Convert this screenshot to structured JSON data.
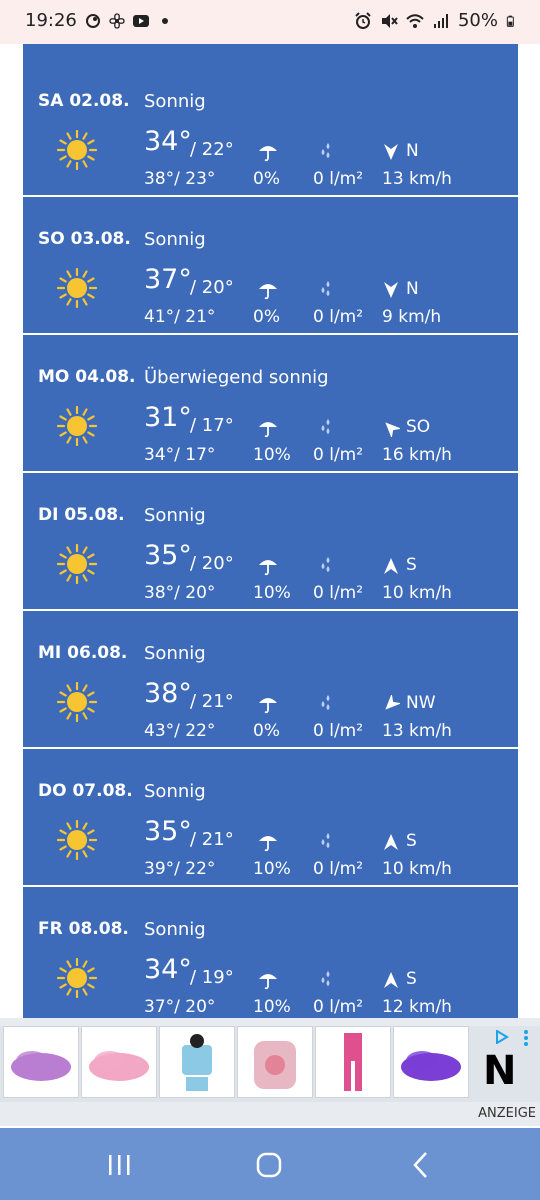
{
  "status_bar": {
    "time": "19:26",
    "battery": "50%",
    "left_icons": [
      "notification-icon",
      "fan-icon",
      "youtube-icon",
      "dot-icon"
    ],
    "right_icons": [
      "alarm-icon",
      "mute-icon",
      "wifi-icon",
      "signal-icon",
      "battery-icon"
    ]
  },
  "forecast": [
    {
      "date": "SA 02.08.",
      "condition": "Sonnig",
      "max": "34°",
      "min": "/ 22°",
      "feels": "38°/ 23°",
      "rain_prob": "0%",
      "rain_amount": "0 l/m²",
      "wind_dir": "N",
      "wind_speed": "13 km/h",
      "wind_arrow_rotation": 180
    },
    {
      "date": "SO 03.08.",
      "condition": "Sonnig",
      "max": "37°",
      "min": "/ 20°",
      "feels": "41°/ 21°",
      "rain_prob": "0%",
      "rain_amount": "0 l/m²",
      "wind_dir": "N",
      "wind_speed": "9 km/h",
      "wind_arrow_rotation": 180
    },
    {
      "date": "MO 04.08.",
      "condition": "Überwiegend sonnig",
      "max": "31°",
      "min": "/ 17°",
      "feels": "34°/ 17°",
      "rain_prob": "10%",
      "rain_amount": "0 l/m²",
      "wind_dir": "SO",
      "wind_speed": "16 km/h",
      "wind_arrow_rotation": -45
    },
    {
      "date": "DI 05.08.",
      "condition": "Sonnig",
      "max": "35°",
      "min": "/ 20°",
      "feels": "38°/ 20°",
      "rain_prob": "10%",
      "rain_amount": "0 l/m²",
      "wind_dir": "S",
      "wind_speed": "10 km/h",
      "wind_arrow_rotation": 0
    },
    {
      "date": "MI 06.08.",
      "condition": "Sonnig",
      "max": "38°",
      "min": "/ 21°",
      "feels": "43°/ 22°",
      "rain_prob": "0%",
      "rain_amount": "0 l/m²",
      "wind_dir": "NW",
      "wind_speed": "13 km/h",
      "wind_arrow_rotation": 225
    },
    {
      "date": "DO 07.08.",
      "condition": "Sonnig",
      "max": "35°",
      "min": "/ 21°",
      "feels": "39°/ 22°",
      "rain_prob": "10%",
      "rain_amount": "0 l/m²",
      "wind_dir": "S",
      "wind_speed": "10 km/h",
      "wind_arrow_rotation": 0
    },
    {
      "date": "FR 08.08.",
      "condition": "Sonnig",
      "max": "34°",
      "min": "/ 19°",
      "feels": "37°/ 20°",
      "rain_prob": "10%",
      "rain_amount": "0 l/m²",
      "wind_dir": "S",
      "wind_speed": "12 km/h",
      "wind_arrow_rotation": 0
    }
  ],
  "ad": {
    "label": "ANZEIGE",
    "brand_letter": "N",
    "items": [
      {
        "name": "ad-item-shoe-purple",
        "color": "#b97ed1"
      },
      {
        "name": "ad-item-shoe-pink",
        "color": "#f2a8c4"
      },
      {
        "name": "ad-item-minnie-set",
        "color": "#8cc9e4"
      },
      {
        "name": "ad-item-backpack",
        "color": "#e7b7c3"
      },
      {
        "name": "ad-item-pink-outfit",
        "color": "#e0508f"
      },
      {
        "name": "ad-item-football-boot",
        "color": "#7b3fd6"
      }
    ]
  },
  "colors": {
    "card_blue": "#3d6bb9",
    "sun": "#f7c531",
    "nav_bar": "#6b93d1"
  }
}
